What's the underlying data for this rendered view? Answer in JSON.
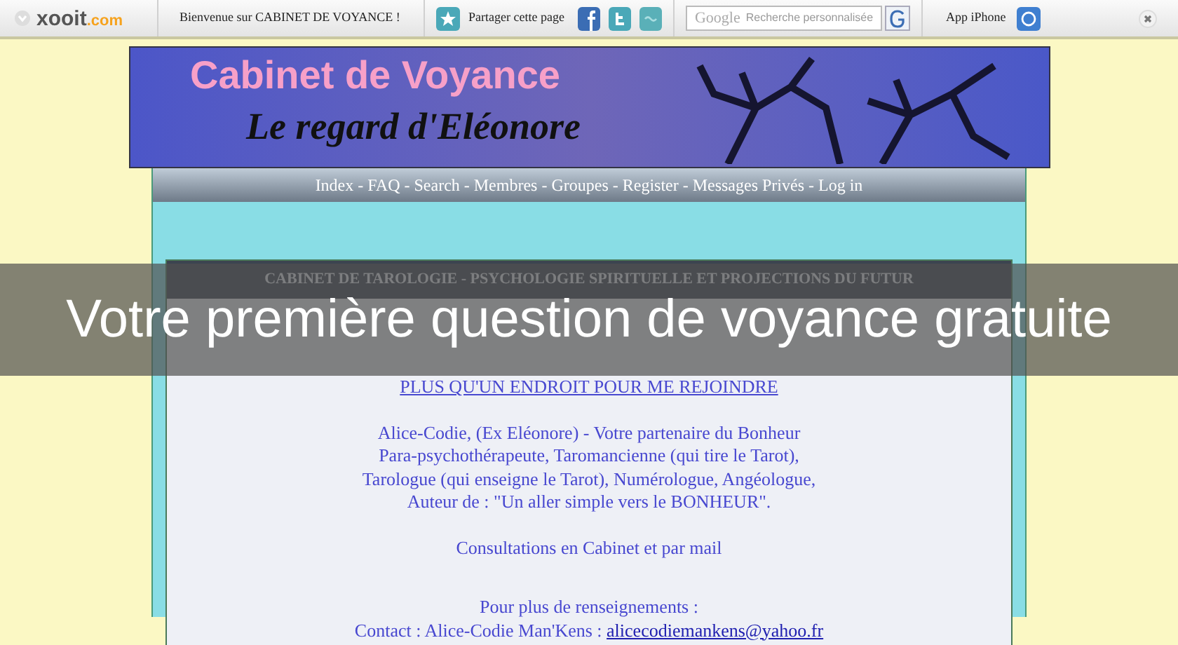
{
  "toolbar": {
    "logo": "xooit",
    "logo_suffix": ".com",
    "welcome": "Bienvenue sur CABINET DE VOYANCE !",
    "share_label": "Partager cette page",
    "search": {
      "brand": "Google",
      "placeholder": "Recherche personnalisée"
    },
    "app_label": "App iPhone"
  },
  "banner": {
    "title": "Cabinet de Voyance",
    "subtitle": "Le regard d'Eléonore"
  },
  "nav": "Index - FAQ - Search - Membres - Groupes - Register - Messages Privés - Log in",
  "panel": {
    "header": "CABINET DE TAROLOGIE - PSYCHOLOGIE SPIRITUELLE ET PROJECTIONS DU FUTUR",
    "blocks": [
      {
        "kind": "link",
        "text": "PLUS QU'UN ENDROIT POUR ME REJOINDRE"
      },
      {
        "kind": "lines",
        "lines": [
          "Alice-Codie, (Ex Eléonore) - Votre partenaire du Bonheur",
          "Para-psychothérapeute, Taromancienne (qui tire le Tarot),",
          "Tarologue (qui enseigne le Tarot), Numérologue, Angéologue,",
          "Auteur de  : \"Un aller simple vers le BONHEUR\"."
        ]
      },
      {
        "kind": "lines",
        "lines": [
          "Consultations en Cabinet et par mail"
        ]
      },
      {
        "kind": "contact",
        "lines": [
          "Pour plus de renseignements :"
        ],
        "label": "Contact : Alice-Codie Man'Kens : ",
        "email": "alicecodiemankens@yahoo.fr"
      }
    ]
  },
  "caption": "Votre première question de voyance gratuite"
}
